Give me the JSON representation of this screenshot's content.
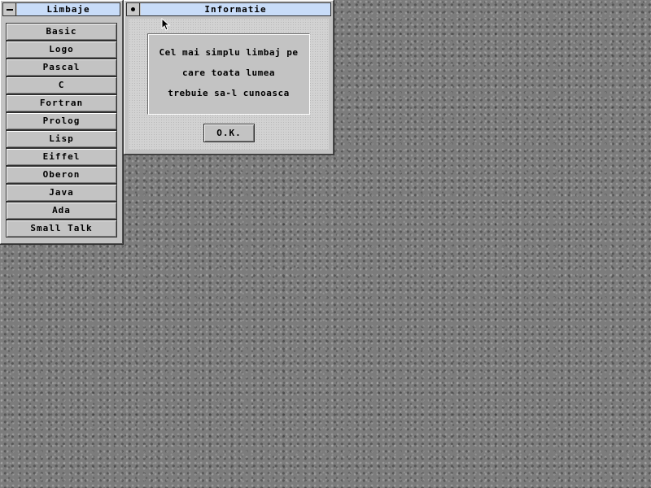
{
  "desktop": {
    "background": "#7c7c7c"
  },
  "languages_window": {
    "title": "Limbaje",
    "close_icon": "minus-icon",
    "items": [
      "Basic",
      "Logo",
      "Pascal",
      "C",
      "Fortran",
      "Prolog",
      "Lisp",
      "Eiffel",
      "Oberon",
      "Java",
      "Ada",
      "Small Talk"
    ]
  },
  "info_window": {
    "title": "Informatie",
    "menu_icon": "dot-icon",
    "message_lines": [
      "Cel mai simplu limbaj pe",
      "care toata lumea",
      "trebuie sa-l cunoasca"
    ],
    "ok_label": "O.K."
  },
  "colors": {
    "title_bar": "#c8dcf8",
    "window_face": "#c3c3c3"
  },
  "cursor_icon": "arrow-cursor-icon"
}
